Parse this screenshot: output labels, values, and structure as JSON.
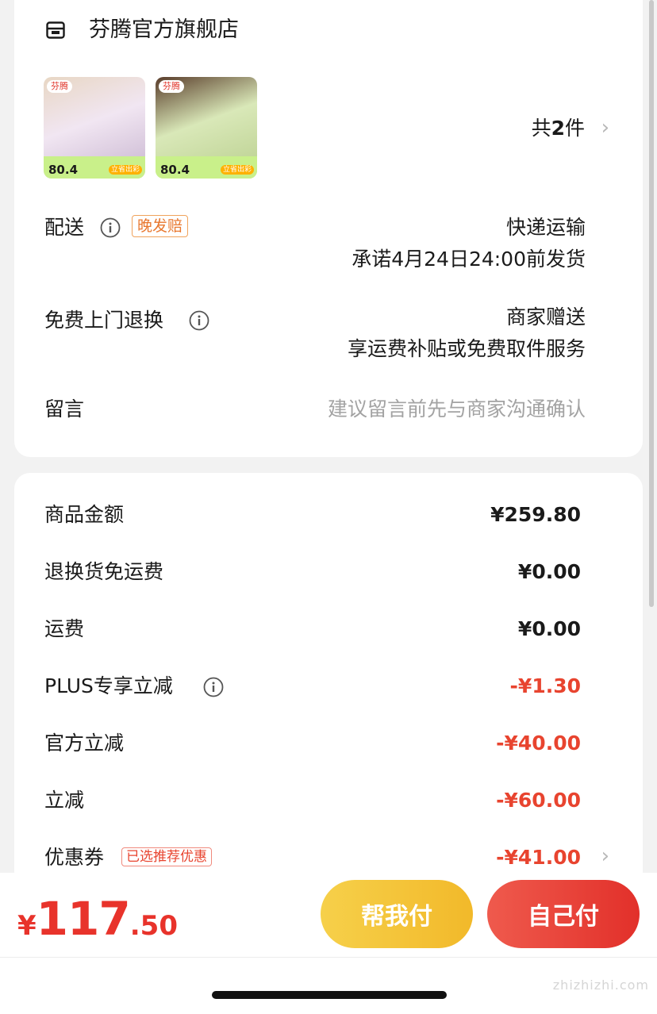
{
  "store": {
    "name": "芬腾官方旗舰店",
    "icon": "store-icon"
  },
  "products": {
    "items": [
      {
        "brand": "芬腾",
        "price": "80.4",
        "tag": "立省出彩"
      },
      {
        "brand": "芬腾",
        "price": "80.4",
        "tag": "立省出彩"
      }
    ],
    "count_prefix": "共",
    "count": "2",
    "count_suffix": "件"
  },
  "delivery": {
    "label": "配送",
    "badge": "晚发赔",
    "method": "快递运输",
    "promise": "承诺4月24日24:00前发货"
  },
  "free_return": {
    "label": "免费上门退换",
    "value_line1": "商家赠送",
    "value_line2": "享运费补贴或免费取件服务"
  },
  "message": {
    "label": "留言",
    "placeholder": "建议留言前先与商家沟通确认"
  },
  "price_rows": [
    {
      "label": "商品金额",
      "value": "¥259.80"
    },
    {
      "label": "退换货免运费",
      "value": "¥0.00"
    },
    {
      "label": "运费",
      "value": "¥0.00"
    },
    {
      "label": "PLUS专享立减",
      "value": "-¥1.30"
    },
    {
      "label": "官方立减",
      "value": "-¥40.00"
    },
    {
      "label": "立减",
      "value": "-¥60.00"
    },
    {
      "label": "优惠券",
      "value": "-¥41.00",
      "badge": "已选推荐优惠"
    }
  ],
  "footer": {
    "currency": "¥",
    "total_int": "117",
    "total_dec": ".50",
    "help_pay": "帮我付",
    "self_pay": "自己付"
  },
  "watermark": "zhizhizhi.com",
  "colors": {
    "red": "#e8442f",
    "gold": "#f2b92a",
    "accent_red": "#e2302a"
  }
}
